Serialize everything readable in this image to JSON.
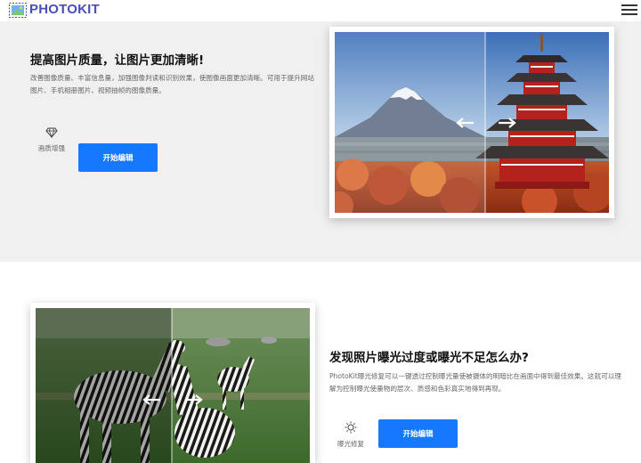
{
  "header": {
    "brand": "PHOTOKIT",
    "logo_icon": "image-logo-icon",
    "menu_icon": "hamburger-menu-icon",
    "brand_color": "#4a4fb6"
  },
  "section1": {
    "title": "提高图片质量，让图片更加清晰!",
    "description": "改善图像质量、丰富信息量，加强图像判读和识别效果，使图像画面更加清晰。可用于提升网站图片、手机相册图片、视频抽帧的图像质量。",
    "feature_label": "画质增强",
    "feature_icon": "diamond-icon",
    "button_label": "开始编辑",
    "compare_icon": "compare-arrows-icon"
  },
  "section2": {
    "title": "发现照片曝光过度或曝光不足怎么办?",
    "description": "PhotoKit曝光修复可以一键透过控制曝光量使被摄体的明暗比在画面中得到最佳效果。这就可以理解为控制曝光使量物的层次、质感和色彩真实地得到再现。",
    "feature_label": "曝光修复",
    "feature_icon": "sun-icon",
    "button_label": "开始编辑",
    "compare_icon": "compare-arrows-icon"
  },
  "colors": {
    "accent": "#1677ff",
    "section_bg": "#f0f0f0"
  }
}
